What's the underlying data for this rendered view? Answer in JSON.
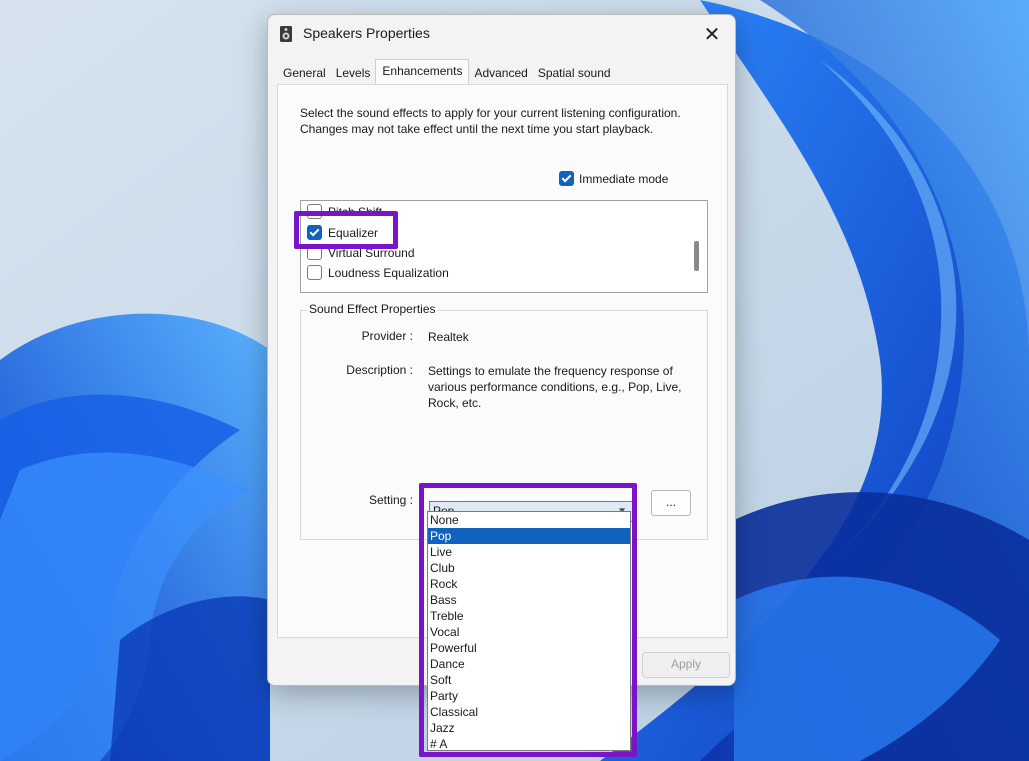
{
  "dialog": {
    "title": "Speakers Properties",
    "close_glyph": "✕"
  },
  "tabs": [
    {
      "label": "General"
    },
    {
      "label": "Levels"
    },
    {
      "label": "Enhancements"
    },
    {
      "label": "Advanced"
    },
    {
      "label": "Spatial sound"
    }
  ],
  "enhancements": {
    "intro": "Select the sound effects to apply for your current listening configuration. Changes may not take effect until the next time you start playback.",
    "immediate_mode": {
      "label": "Immediate mode",
      "checked": true
    },
    "effects": [
      {
        "label": "Pitch Shift",
        "checked": false
      },
      {
        "label": "Equalizer",
        "checked": true
      },
      {
        "label": "Virtual Surround",
        "checked": false
      },
      {
        "label": "Loudness Equalization",
        "checked": false
      }
    ],
    "group_title": "Sound Effect Properties",
    "provider_label": "Provider :",
    "provider_value": "Realtek",
    "description_label": "Description :",
    "description_value": "Settings to emulate the frequency response of various performance conditions,  e.g., Pop, Live, Rock, etc.",
    "setting_label": "Setting :",
    "setting_value": "Pop",
    "more_button": "...",
    "setting_options": [
      "None",
      "Pop",
      "Live",
      "Club",
      "Rock",
      "Bass",
      "Treble",
      "Vocal",
      "Powerful",
      "Dance",
      "Soft",
      "Party",
      "Classical",
      "Jazz",
      "# A"
    ],
    "selected_option": "Pop"
  },
  "footer": {
    "apply_label": "Apply"
  },
  "colors": {
    "accent": "#0f62be",
    "highlight": "#7a14c8"
  }
}
